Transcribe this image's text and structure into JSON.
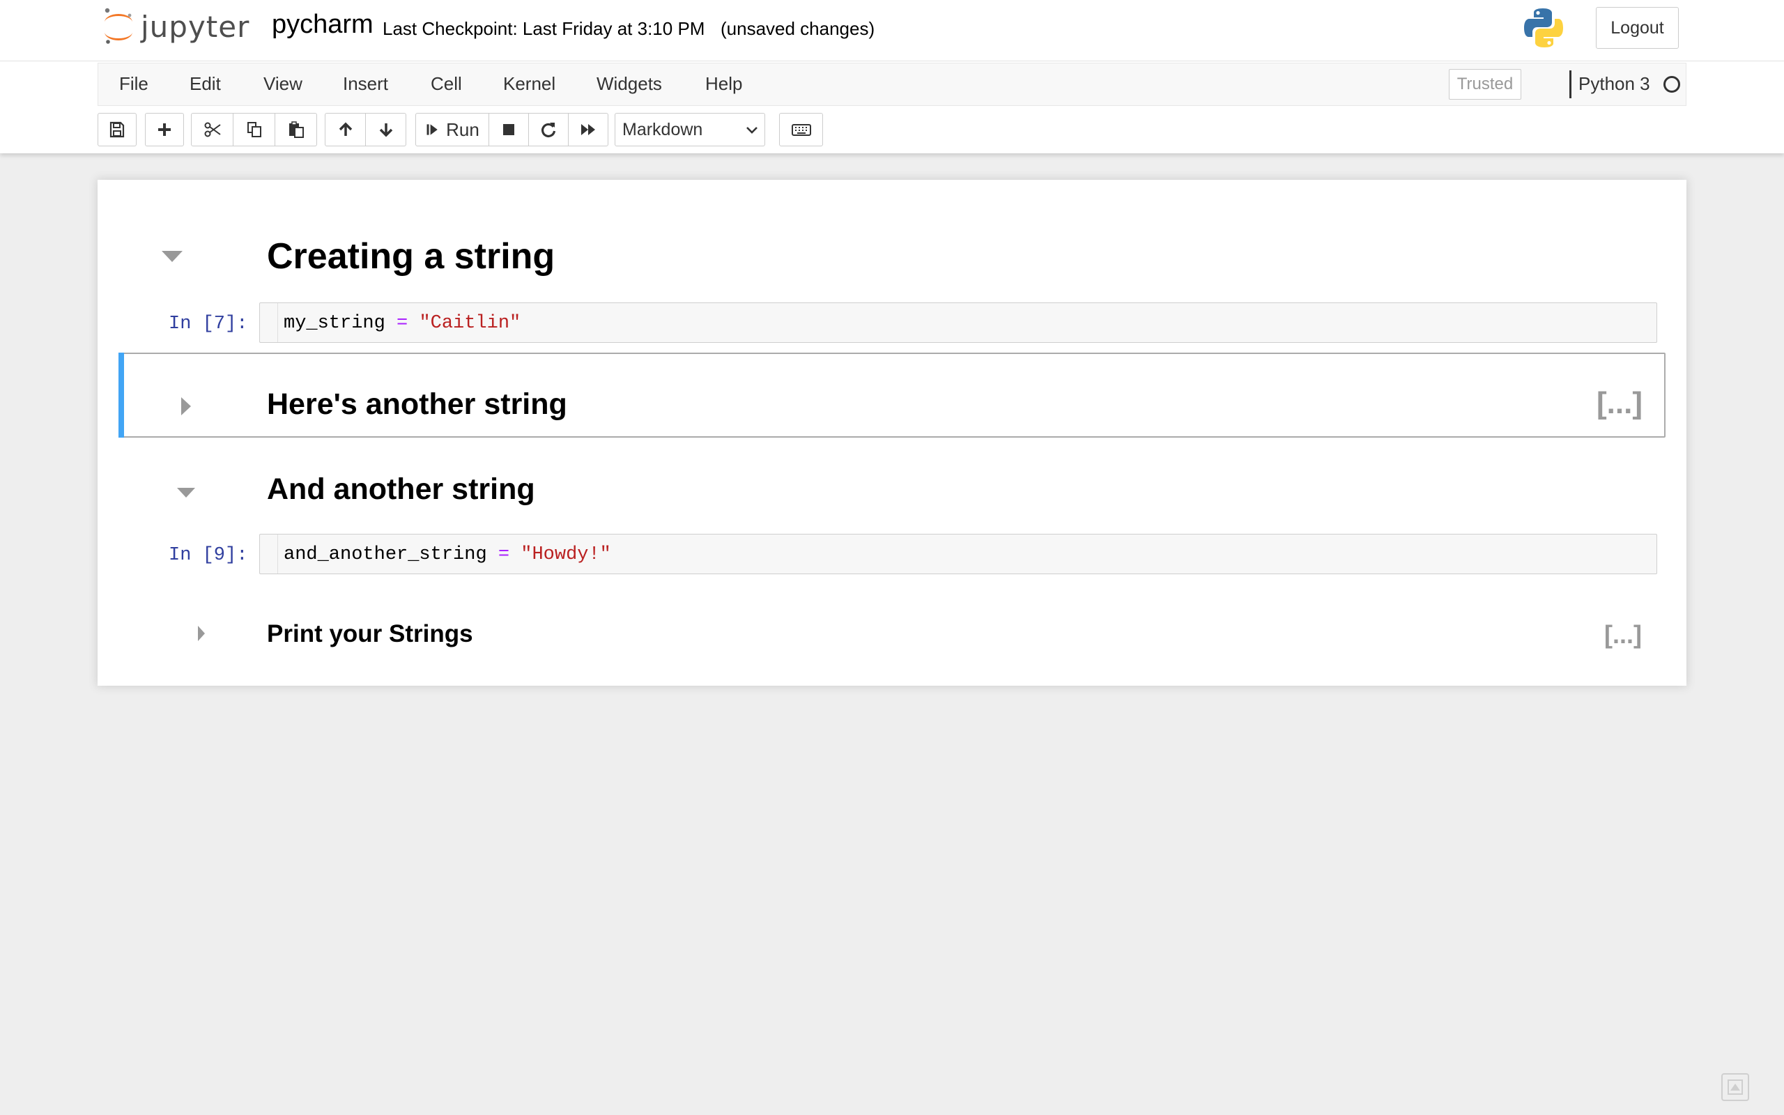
{
  "app": {
    "logo_text": "jupyter",
    "notebook_name": "pycharm",
    "checkpoint": "Last Checkpoint: Last Friday at 3:10 PM",
    "autosave": "(unsaved changes)",
    "logout_label": "Logout"
  },
  "menubar": {
    "items": [
      "File",
      "Edit",
      "View",
      "Insert",
      "Cell",
      "Kernel",
      "Widgets",
      "Help"
    ],
    "trusted": "Trusted",
    "kernel_name": "Python 3"
  },
  "toolbar": {
    "run_label": "Run",
    "cell_type": "Markdown",
    "icons": [
      "save-icon",
      "plus-icon",
      "cut-icon",
      "copy-icon",
      "paste-icon",
      "arrow-up-icon",
      "arrow-down-icon",
      "step-forward-icon",
      "stop-icon",
      "restart-icon",
      "fast-forward-icon",
      "keyboard-icon"
    ]
  },
  "cells": {
    "h1": {
      "text": "Creating a string",
      "collapsed": false
    },
    "code1": {
      "prompt": "In [7]:",
      "var": "my_string",
      "op": "=",
      "str": "\"Caitlin\""
    },
    "h2": {
      "text": "Here's another string",
      "collapsed": true,
      "ellipsis": "[...]"
    },
    "h3": {
      "text": "And another string",
      "collapsed": false
    },
    "code2": {
      "prompt": "In [9]:",
      "var": "and_another_string",
      "op": "=",
      "str": "\"Howdy!\""
    },
    "h4": {
      "text": "Print your Strings",
      "collapsed": true,
      "ellipsis": "[...]"
    }
  },
  "colors": {
    "selected_bar": "#42a5f5",
    "prompt": "#303f9f",
    "string": "#ba2121",
    "operator": "#aa22ff"
  }
}
